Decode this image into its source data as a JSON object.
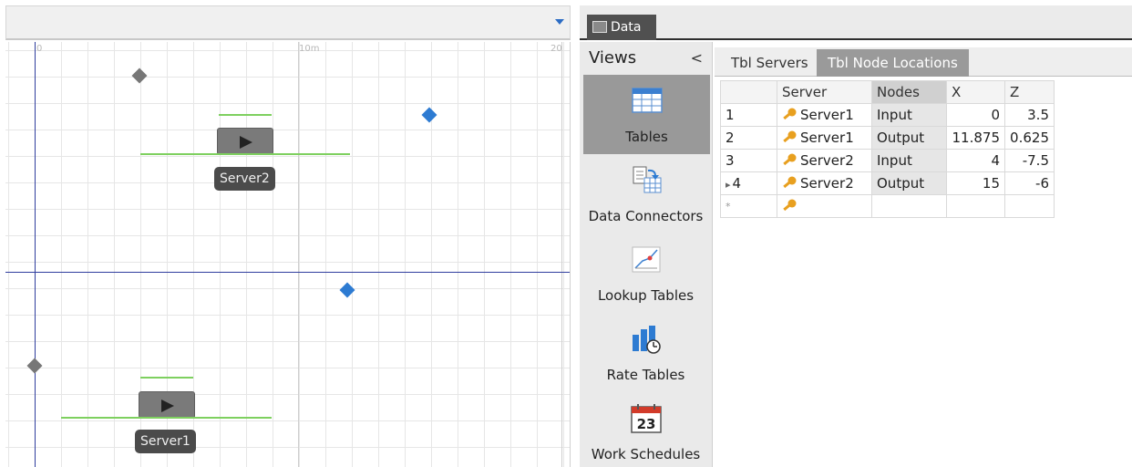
{
  "canvas": {
    "ruler_labels": [
      "0",
      "10m",
      "20"
    ],
    "servers": [
      {
        "name": "Server2"
      },
      {
        "name": "Server1"
      }
    ]
  },
  "panel": {
    "data_tab_label": "Data"
  },
  "views": {
    "title": "Views",
    "collapse_glyph": "<",
    "items": [
      {
        "label": "Tables",
        "icon": "table-icon"
      },
      {
        "label": "Data Connectors",
        "icon": "data-connector-icon"
      },
      {
        "label": "Lookup Tables",
        "icon": "lookup-chart-icon"
      },
      {
        "label": "Rate Tables",
        "icon": "rate-table-icon"
      },
      {
        "label": "Work Schedules",
        "icon": "calendar-icon"
      }
    ],
    "calendar_day": "23"
  },
  "subtabs": [
    "Tbl Servers",
    "Tbl Node Locations"
  ],
  "grid": {
    "columns": [
      "Server",
      "Nodes",
      "X",
      "Z"
    ],
    "rows": [
      {
        "num": "1",
        "server": "Server1",
        "nodes": "Input",
        "x": "0",
        "z": "3.5"
      },
      {
        "num": "2",
        "server": "Server1",
        "nodes": "Output",
        "x": "11.875",
        "z": "0.625"
      },
      {
        "num": "3",
        "server": "Server2",
        "nodes": "Input",
        "x": "4",
        "z": "-7.5"
      },
      {
        "num": "4",
        "server": "Server2",
        "nodes": "Output",
        "x": "15",
        "z": "-6"
      }
    ],
    "current_row_marker": "▸",
    "new_row_marker": "*"
  },
  "colors": {
    "axis": "#2f3d9e",
    "node_blue": "#2d7bd2",
    "path_green": "#7ed05f",
    "key_gold": "#e8a020"
  }
}
